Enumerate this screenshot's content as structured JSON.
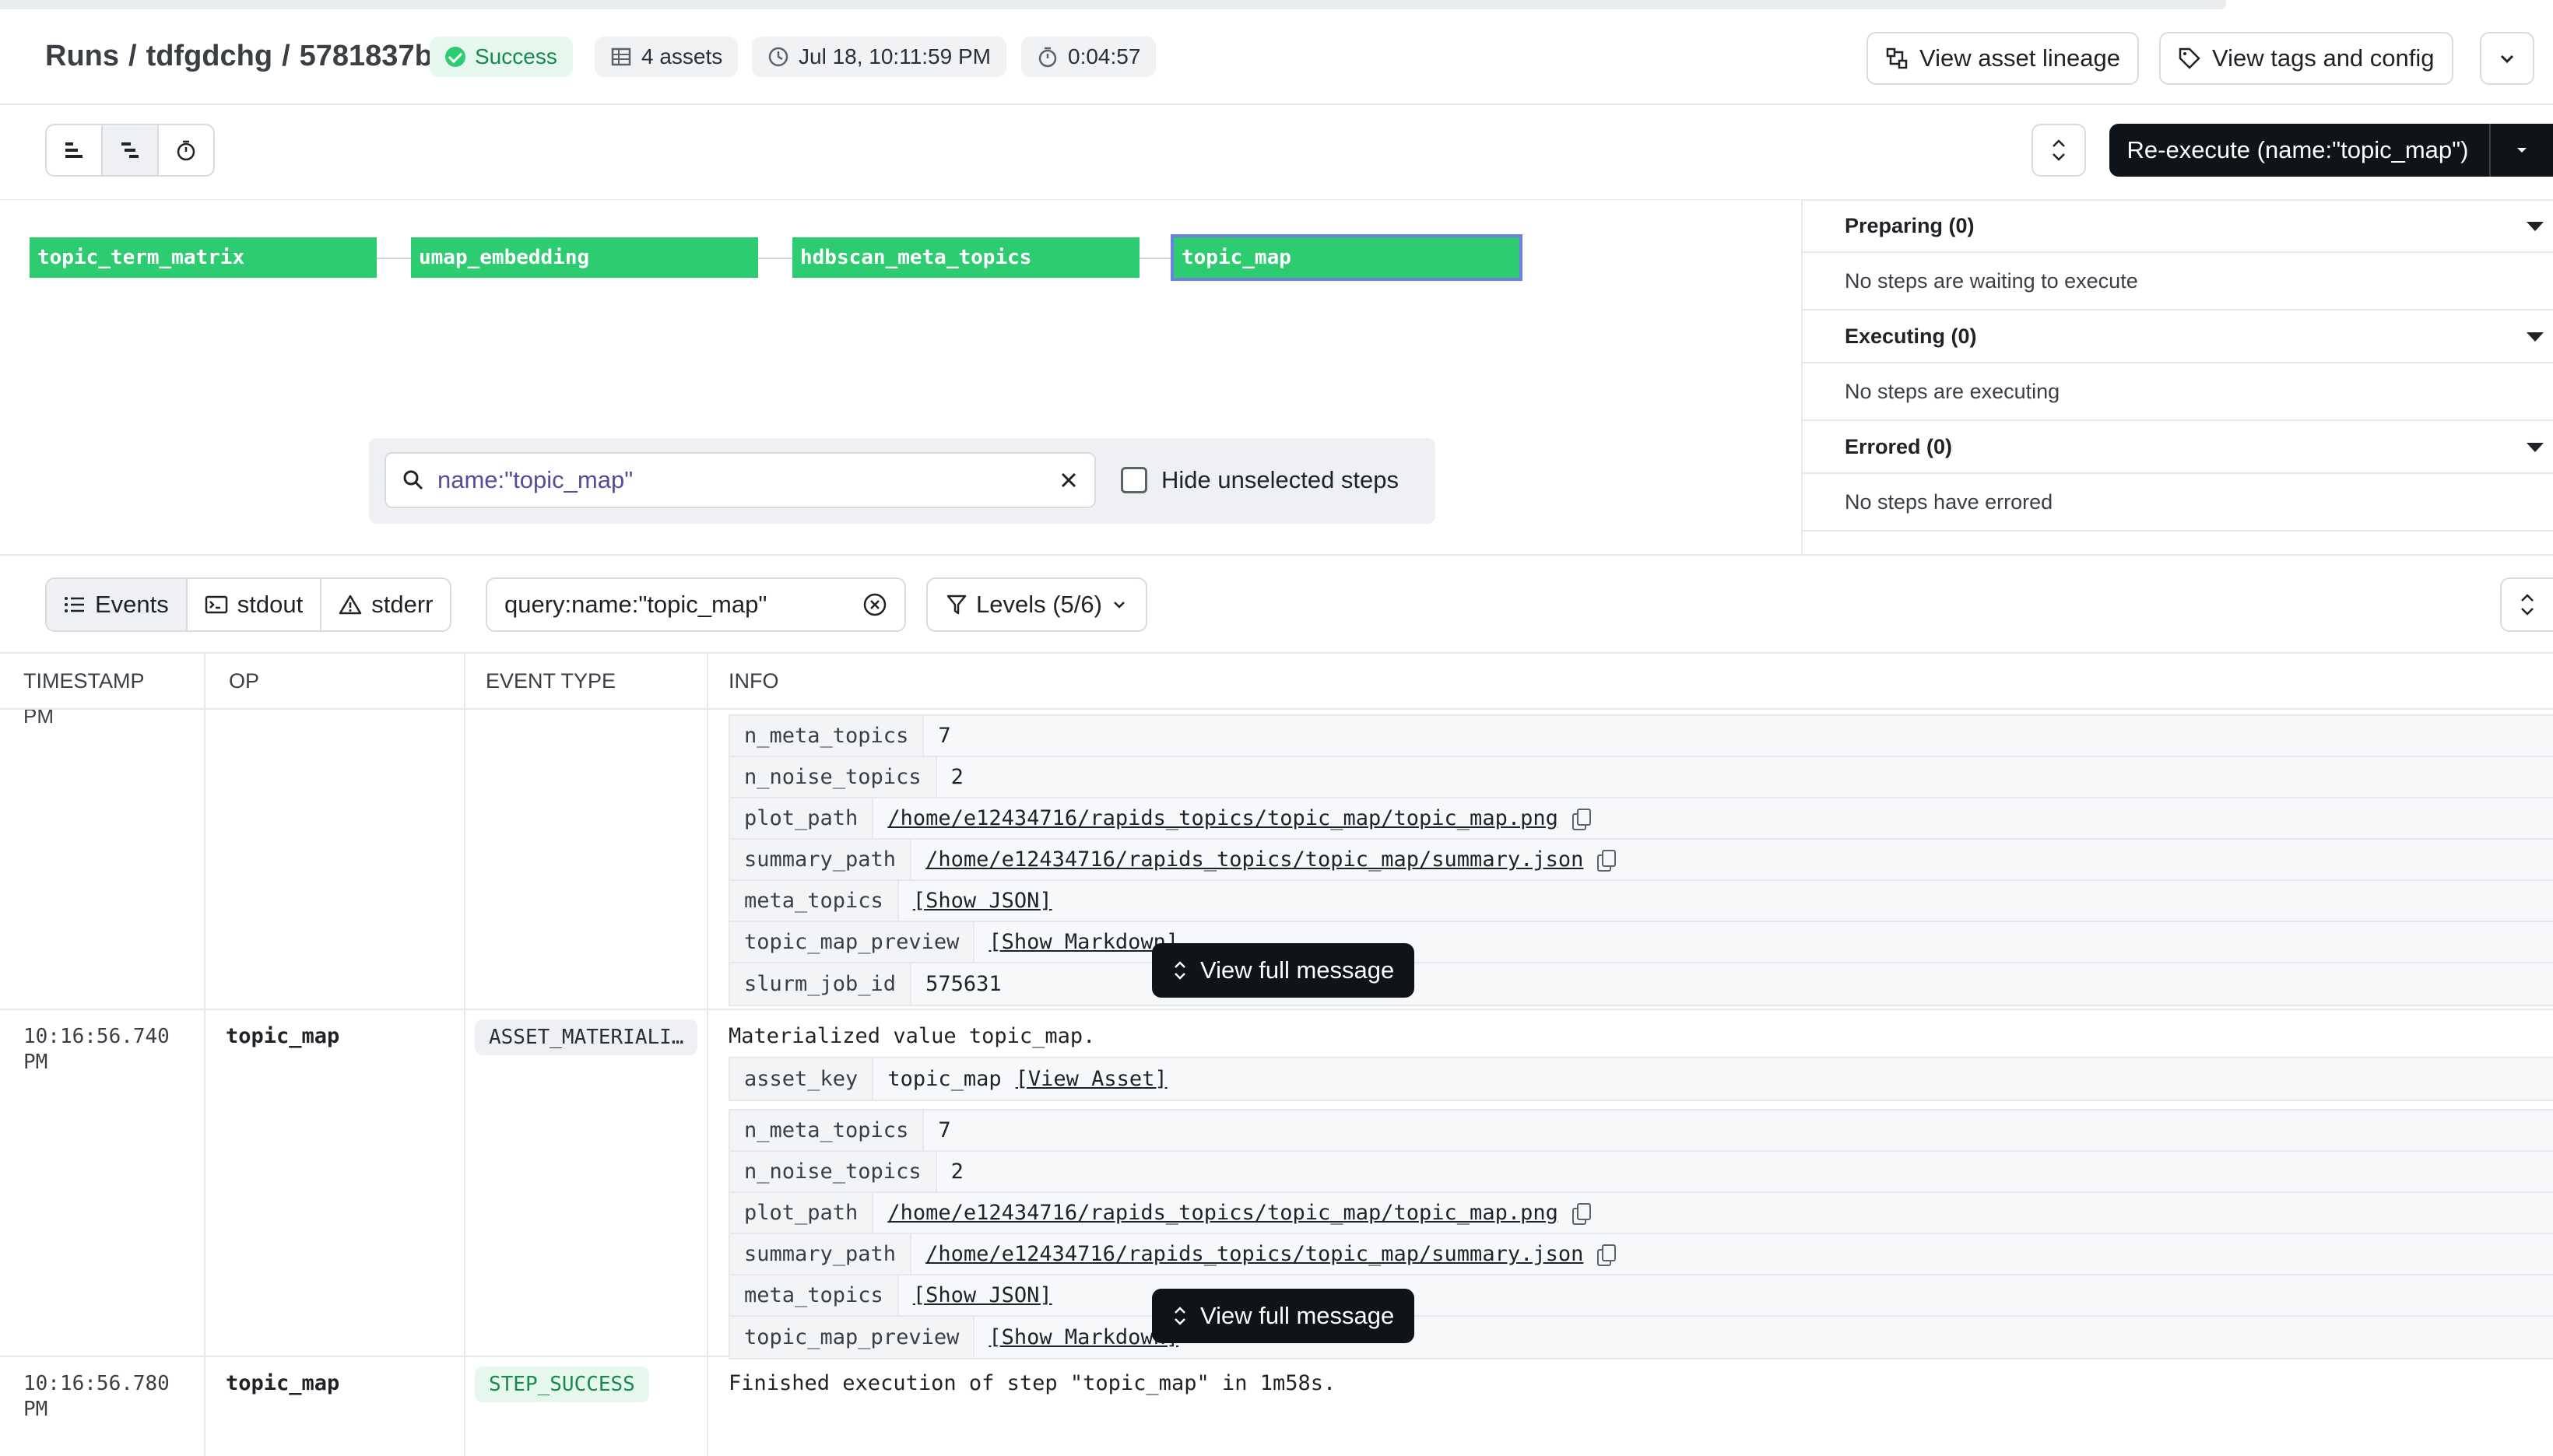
{
  "breadcrumb": {
    "root": "Runs",
    "job": "tdfgdchg",
    "run_id": "5781837b"
  },
  "run_status": {
    "label": "Success",
    "color": "#2ecc71"
  },
  "assets_count": "4 assets",
  "run_start": "Jul 18, 10:11:59 PM",
  "run_duration": "0:04:57",
  "header_actions": {
    "lineage": "View asset lineage",
    "tags": "View tags and config"
  },
  "reexecute": {
    "label": "Re-execute (name:\"topic_map\")"
  },
  "graph": {
    "nodes": [
      {
        "label": "topic_term_matrix"
      },
      {
        "label": "umap_embedding"
      },
      {
        "label": "hdbscan_meta_topics"
      },
      {
        "label": "topic_map"
      }
    ],
    "search": {
      "value": "name:\"topic_map\""
    },
    "hide_unselected_label": "Hide unselected steps"
  },
  "status_panel": [
    {
      "title": "Preparing (0)",
      "body": "No steps are waiting to execute"
    },
    {
      "title": "Executing (0)",
      "body": "No steps are executing"
    },
    {
      "title": "Errored (0)",
      "body": "No steps have errored"
    }
  ],
  "logs": {
    "tabs": [
      "Events",
      "stdout",
      "stderr"
    ],
    "filter_value": "query:name:\"topic_map\"",
    "levels_label": "Levels (5/6)",
    "columns": [
      "TIMESTAMP",
      "OP",
      "EVENT TYPE",
      "INFO"
    ],
    "partial_timestamp": "PM",
    "row1_kv": [
      {
        "k": "n_meta_topics",
        "v": "7"
      },
      {
        "k": "n_noise_topics",
        "v": "2"
      },
      {
        "k": "plot_path",
        "v": "/home/e12434716/rapids_topics/topic_map/topic_map.png"
      },
      {
        "k": "summary_path",
        "v": "/home/e12434716/rapids_topics/topic_map/summary.json"
      },
      {
        "k": "meta_topics",
        "v": "[Show JSON]"
      },
      {
        "k": "topic_map_preview",
        "v": "[Show Markdown]"
      },
      {
        "k": "slurm_job_id",
        "v": "575631"
      }
    ],
    "row2": {
      "timestamp": "10:16:56.740 PM",
      "op": "topic_map",
      "event_type": "ASSET_MATERIALI…",
      "message": "Materialized value topic_map.",
      "asset_key_label": "asset_key",
      "asset_key_value": "topic_map",
      "asset_link": "[View Asset]",
      "kv": [
        {
          "k": "n_meta_topics",
          "v": "7"
        },
        {
          "k": "n_noise_topics",
          "v": "2"
        },
        {
          "k": "plot_path",
          "v": "/home/e12434716/rapids_topics/topic_map/topic_map.png"
        },
        {
          "k": "summary_path",
          "v": "/home/e12434716/rapids_topics/topic_map/summary.json"
        },
        {
          "k": "meta_topics",
          "v": "[Show JSON]"
        },
        {
          "k": "topic_map_preview",
          "v": "[Show Markdown]"
        }
      ]
    },
    "row3": {
      "timestamp": "10:16:56.780 PM",
      "op": "topic_map",
      "event_type": "STEP_SUCCESS",
      "message": "Finished execution of step \"topic_map\" in 1m58s."
    },
    "view_full_message": "View full message"
  }
}
